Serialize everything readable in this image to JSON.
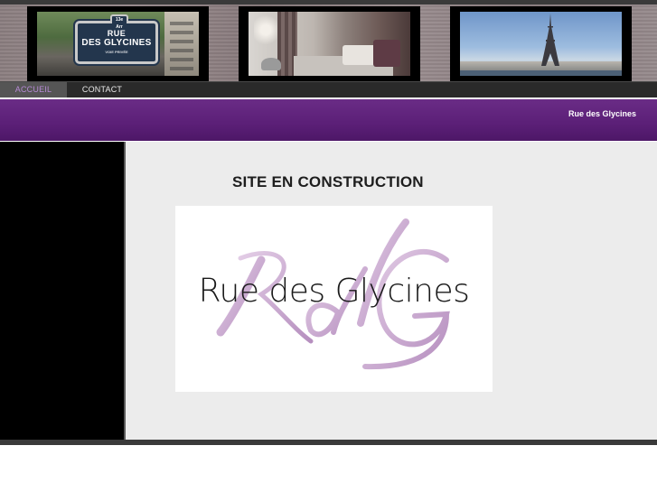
{
  "banner": {
    "photos": [
      {
        "name": "street-sign-photo",
        "sign_top": "13e Arr",
        "sign_line1": "RUE",
        "sign_line2": "DES GLYCINES",
        "sign_line3": "VOIE PRIVÉE"
      },
      {
        "name": "room-photo"
      },
      {
        "name": "eiffel-tower-photo"
      }
    ]
  },
  "nav": {
    "items": [
      {
        "label": "ACCUEIL",
        "active": true
      },
      {
        "label": "CONTACT",
        "active": false
      }
    ]
  },
  "band": {
    "title": "Rue des Glycines",
    "color": "#5b1f77"
  },
  "main": {
    "heading": "SITE EN CONSTRUCTION",
    "logo": {
      "monogram": "RdG",
      "text": "Rue des Glycines",
      "monogram_color": "#c9a6cf"
    }
  }
}
